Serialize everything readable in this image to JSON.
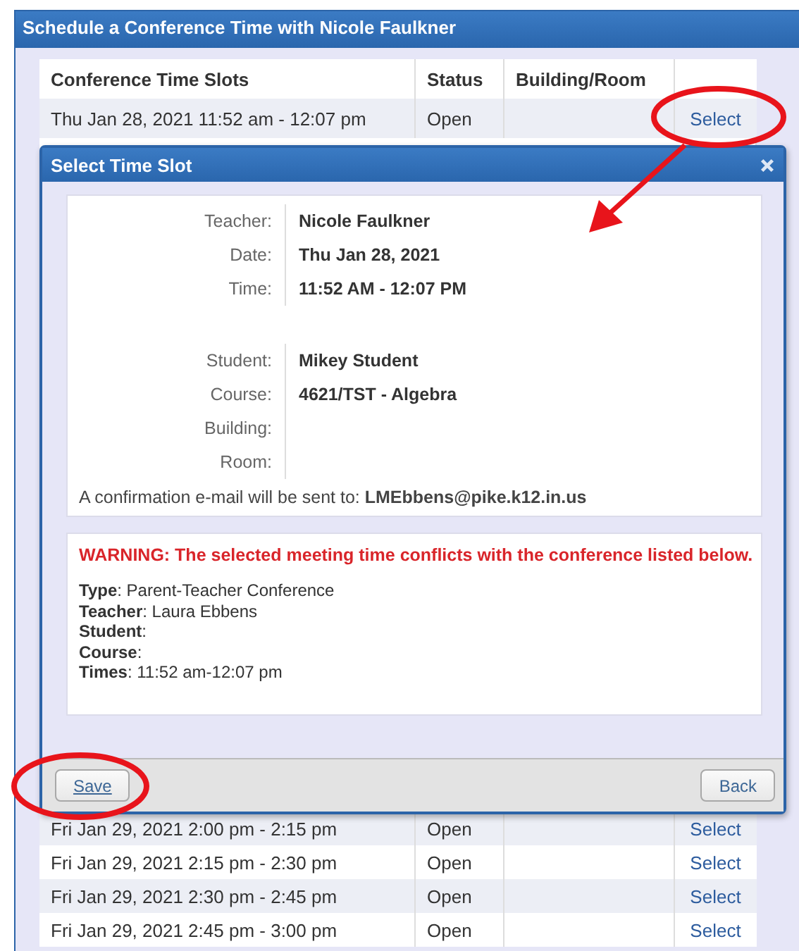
{
  "window": {
    "title": "Schedule a Conference Time with Nicole Faulkner"
  },
  "table": {
    "columns": [
      "Conference Time Slots",
      "Status",
      "Building/Room"
    ],
    "rows_top": [
      {
        "time": "Thu Jan 28, 2021 11:52 am - 12:07 pm",
        "status": "Open",
        "action": "Select"
      }
    ],
    "rows_bottom": [
      {
        "time": "Fri Jan 29, 2021 2:00 pm - 2:15 pm",
        "status": "Open",
        "action": "Select"
      },
      {
        "time": "Fri Jan 29, 2021 2:15 pm - 2:30 pm",
        "status": "Open",
        "action": "Select"
      },
      {
        "time": "Fri Jan 29, 2021 2:30 pm - 2:45 pm",
        "status": "Open",
        "action": "Select"
      },
      {
        "time": "Fri Jan 29, 2021 2:45 pm - 3:00 pm",
        "status": "Open",
        "action": "Select"
      }
    ]
  },
  "dialog": {
    "title": "Select Time Slot",
    "detail_groups": [
      [
        {
          "label": "Teacher:",
          "value": "Nicole Faulkner"
        },
        {
          "label": "Date:",
          "value": "Thu Jan 28, 2021"
        },
        {
          "label": "Time:",
          "value": "11:52 AM - 12:07 PM"
        }
      ],
      [
        {
          "label": "Student:",
          "value": "Mikey Student"
        },
        {
          "label": "Course:",
          "value": "4621/TST - Algebra"
        },
        {
          "label": "Building:"
        },
        {
          "label": "Room:"
        }
      ]
    ],
    "confirmation": "A confirmation e-mail will be sent to: **LMEbbens@pike.k12.in.us**",
    "warning": "WARNING: The selected meeting time conflicts with the conference listed below.",
    "conflict": [
      "**Type**: Parent-Teacher Conference",
      "**Teacher**: Laura Ebbens",
      "**Student**:",
      "**Course**:",
      "**Times**: 11:52 am-12:07 pm"
    ],
    "buttons": [
      "Save",
      "Back"
    ]
  }
}
